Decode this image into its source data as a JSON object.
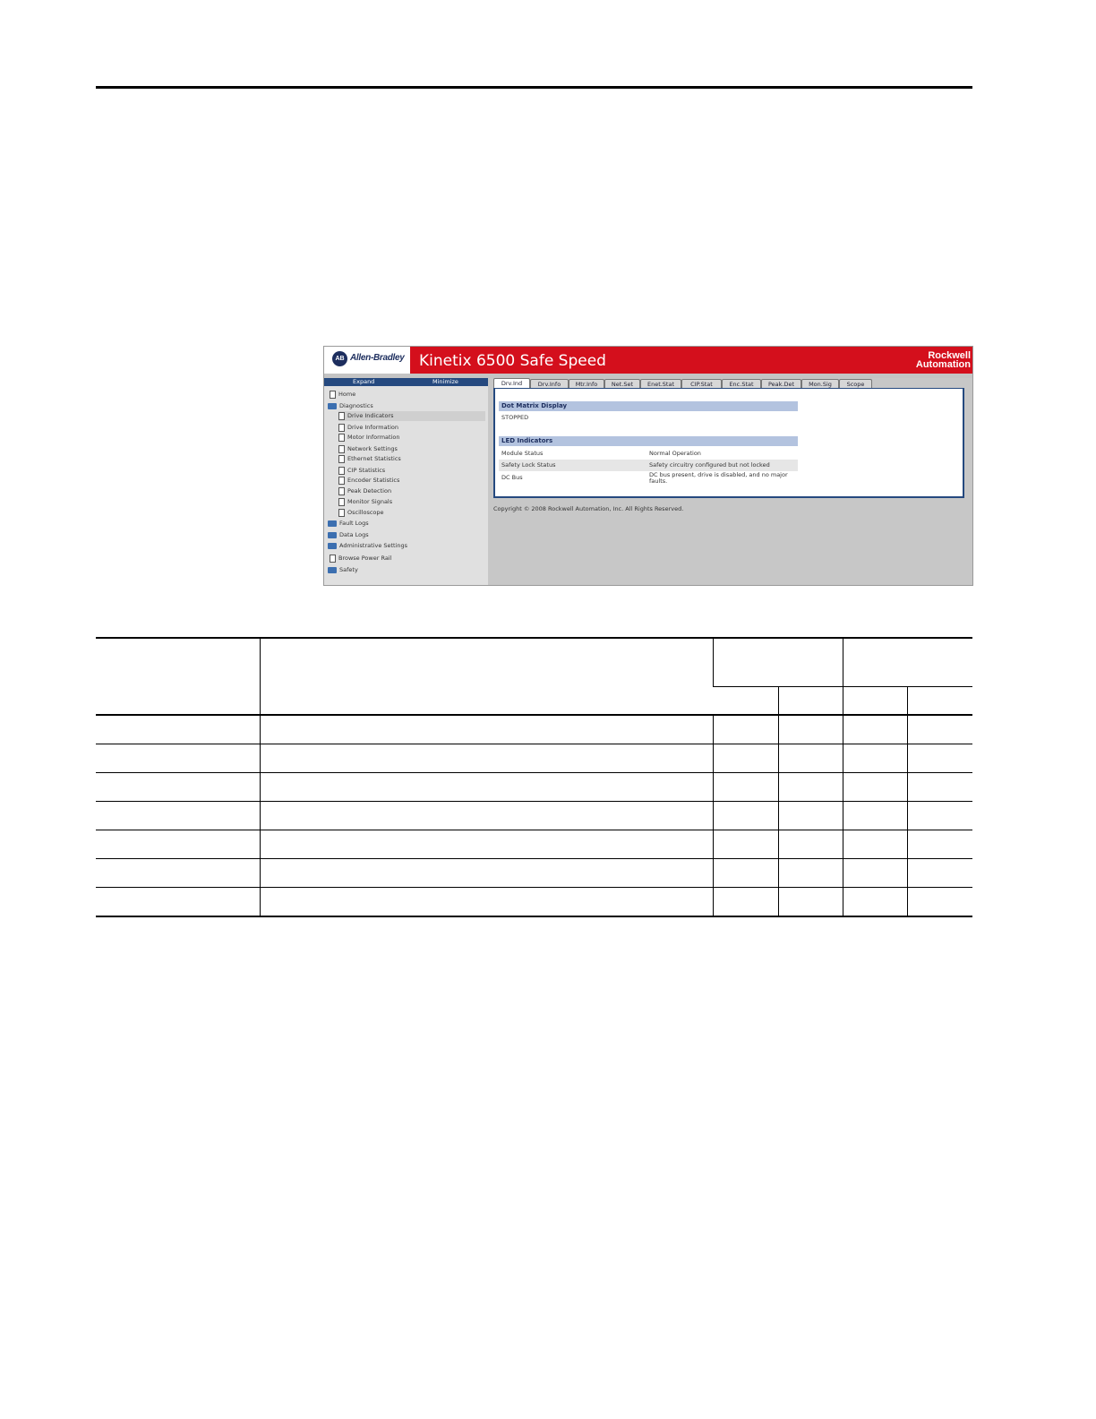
{
  "banner": {
    "ab_logo_letters": "AB",
    "ab_brand": "Allen-Bradley",
    "product_title": "Kinetix 6500 Safe Speed",
    "rockwell_line1": "Rockwell",
    "rockwell_line2": "Automation"
  },
  "sidebar": {
    "expand_label": "Expand",
    "minimize_label": "Minimize",
    "items": [
      {
        "label": "Home",
        "icon": "document-icon"
      },
      {
        "label": "Diagnostics",
        "icon": "folder-open-icon"
      },
      {
        "label": "Drive Indicators",
        "icon": "document-icon",
        "selected": true
      },
      {
        "label": "Drive Information",
        "icon": "document-icon"
      },
      {
        "label": "Motor Information",
        "icon": "document-icon"
      },
      {
        "label": "Network Settings",
        "icon": "document-icon"
      },
      {
        "label": "Ethernet Statistics",
        "icon": "document-icon"
      },
      {
        "label": "CIP Statistics",
        "icon": "document-icon"
      },
      {
        "label": "Encoder Statistics",
        "icon": "document-icon"
      },
      {
        "label": "Peak Detection",
        "icon": "document-icon"
      },
      {
        "label": "Monitor Signals",
        "icon": "document-icon"
      },
      {
        "label": "Oscilloscope",
        "icon": "document-icon"
      },
      {
        "label": "Fault Logs",
        "icon": "folder-icon"
      },
      {
        "label": "Data Logs",
        "icon": "folder-icon"
      },
      {
        "label": "Administrative Settings",
        "icon": "folder-icon"
      },
      {
        "label": "Browse Power Rail",
        "icon": "document-icon"
      },
      {
        "label": "Safety",
        "icon": "folder-icon"
      }
    ]
  },
  "tabs": [
    "Drv.Ind",
    "Drv.Info",
    "Mtr.Info",
    "Net.Set",
    "Enet.Stat",
    "CIP.Stat",
    "Enc.Stat",
    "Peak.Det",
    "Mon.Sig",
    "Scope"
  ],
  "panel": {
    "dot_matrix_heading": "Dot Matrix Display",
    "dot_matrix_value": "STOPPED",
    "led_heading": "LED Indicators",
    "rows": [
      {
        "name": "Module Status",
        "value": "Normal Operation"
      },
      {
        "name": "Safety Lock Status",
        "value": "Safety circuitry configured but not locked"
      },
      {
        "name": "DC Bus",
        "value": "DC bus present, drive is disabled, and no major faults."
      }
    ]
  },
  "copyright": "Copyright © 2008 Rockwell Automation, Inc. All Rights Reserved.",
  "colors": {
    "banner_red": "#d40f1c",
    "nav_blue": "#25497f",
    "section_head": "#b3c3df"
  }
}
